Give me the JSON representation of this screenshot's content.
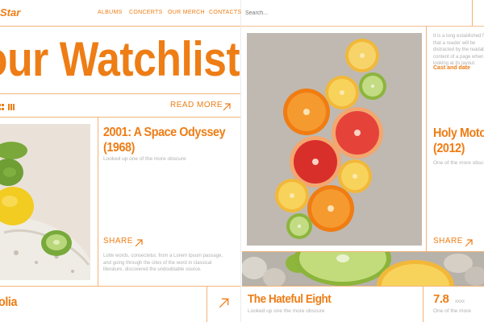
{
  "header": {
    "logo": "Star",
    "nav": [
      "ALBUMS",
      "CONCERTS",
      "OUR MERCH",
      "CONTACTS"
    ],
    "search_placeholder": "Search..."
  },
  "hero": {
    "title": "our Watchlist",
    "read_more": "READ MORE"
  },
  "cards": [
    {
      "title_line1": "2001: A Space Odyssey",
      "title_line2": "(1968)",
      "subtitle": "Looked up one of the more obscure",
      "share": "SHARE",
      "body": "Lotte words, consectetur, from a Lorem Ipsum passage, and going through the cites of the word in classical literature, discovered the undoubtable source."
    },
    {
      "intro": "It is a long established fact that a reader will be distracted by the readable content of a page when looking at its layout.",
      "cast": "Cast and date",
      "title_line1": "Holy Motors",
      "title_line2": "(2012)",
      "subtitle": "One of the more obscure",
      "share": "SHARE"
    }
  ],
  "bottom": {
    "left_title": "olia",
    "hateful_title": "The Hateful Eight",
    "hateful_subtitle": "Looked up one the more obscure",
    "rating": "7.8",
    "rating_suffix": "xxxx",
    "rating_subtitle": "One of the more"
  },
  "colors": {
    "accent": "#ee7d15",
    "divider": "#f2b477",
    "muted_text": "#b0b0b0"
  },
  "icons": [
    "arrow-up-right-icon",
    "grid-view-icon",
    "list-view-icon"
  ]
}
